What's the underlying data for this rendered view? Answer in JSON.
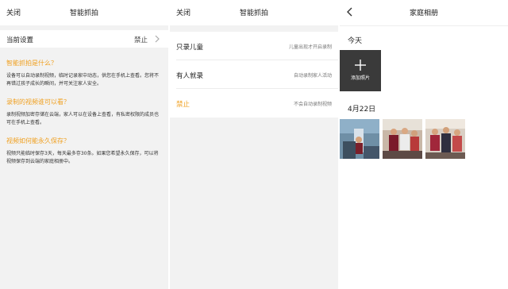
{
  "panel1": {
    "nav": {
      "close_label": "关闭",
      "title": "智能抓拍"
    },
    "setting": {
      "label": "当前设置",
      "value": "禁止"
    },
    "faq": [
      {
        "question": "智能抓拍是什么？",
        "answer": "设备可以自动录制视频，临时记录家中动态，供您在手机上查看。您将不再错过孩子成长的瞬间，并可关注家人安全。"
      },
      {
        "question": "录制的视频谁可以看？",
        "answer": "录制视频加密存储在云端，家人可以在设备上查看，有私密权限的成员也可在手机上查看。"
      },
      {
        "question": "视频如何能永久保存？",
        "answer": "视频只能临时保存3天，每天最多存30条。如果您希望永久保存，可以将视频保存到云端的家庭相册中。"
      }
    ]
  },
  "panel2": {
    "nav": {
      "close_label": "关闭",
      "title": "智能抓拍"
    },
    "options": [
      {
        "name": "只录儿童",
        "desc": "儿童出现才开启录制"
      },
      {
        "name": "有人就录",
        "desc": "自动录制家人活动"
      },
      {
        "name": "禁止",
        "desc": "不会自动录制视频"
      }
    ]
  },
  "panel3": {
    "nav": {
      "title": "家庭相册"
    },
    "today_label": "今天",
    "add_photo_label": "添加照片",
    "date_label": "4月22日"
  },
  "colors": {
    "accent": "#f0a020",
    "background": "#f2f2f2",
    "tile": "#3a3a3a"
  },
  "icons": [
    "chevron-right-icon",
    "back-arrow-icon",
    "plus-icon"
  ]
}
